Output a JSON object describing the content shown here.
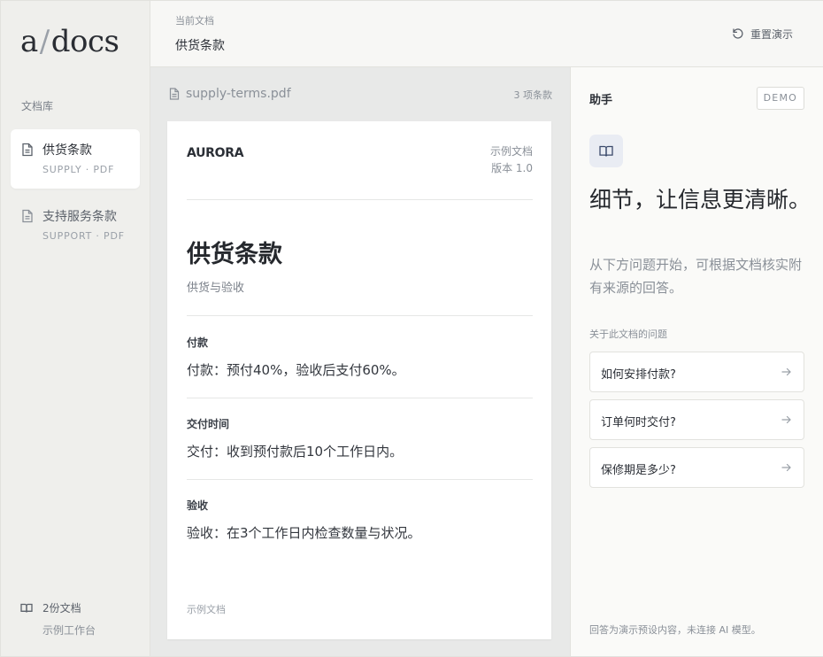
{
  "sidebar": {
    "logo_a": "a",
    "logo_slash": "/",
    "logo_docs": "docs",
    "library_label": "文档库",
    "items": [
      {
        "title": "供货条款",
        "sub": "SUPPLY · PDF",
        "active": true
      },
      {
        "title": "支持服务条款",
        "sub": "SUPPORT · PDF",
        "active": false
      }
    ],
    "footer_count": "2份文档",
    "footer_workspace": "示例工作台"
  },
  "topbar": {
    "current_label": "当前文档",
    "current_title": "供货条款",
    "reset_label": "重置演示"
  },
  "viewer": {
    "file_name": "supply-terms.pdf",
    "clause_count": "3 项条款",
    "page": {
      "brand": "AURORA",
      "sample_line1": "示例文档",
      "sample_line2": "版本 1.0",
      "title": "供货条款",
      "subtitle": "供货与验收",
      "sections": [
        {
          "title": "付款",
          "body": "付款：预付40%，验收后支付60%。"
        },
        {
          "title": "交付时间",
          "body": "交付：收到预付款后10个工作日内。"
        },
        {
          "title": "验收",
          "body": "验收：在3个工作日内检查数量与状况。"
        }
      ],
      "footer": "示例文档"
    }
  },
  "assistant": {
    "title": "助手",
    "badge": "DEMO",
    "headline": "细节，让信息更清晰。",
    "intro": "从下方问题开始，可根据文档核实附有来源的回答。",
    "questions_label": "关于此文档的问题",
    "questions": [
      "如何安排付款?",
      "订单何时交付?",
      "保修期是多少?"
    ],
    "footer": "回答为演示预设内容，未连接 AI 模型。"
  },
  "colors": {
    "sidebar_bg": "#efefec",
    "viewer_bg": "#e8e9e8",
    "accent_tile": "#e9ecf3",
    "text_primary": "#2b2f36",
    "text_muted": "#8a9098"
  },
  "icons": {
    "doc": "file-text-icon",
    "book": "book-open-icon",
    "reset": "rotate-ccw-icon",
    "arrow": "arrow-right-icon"
  }
}
